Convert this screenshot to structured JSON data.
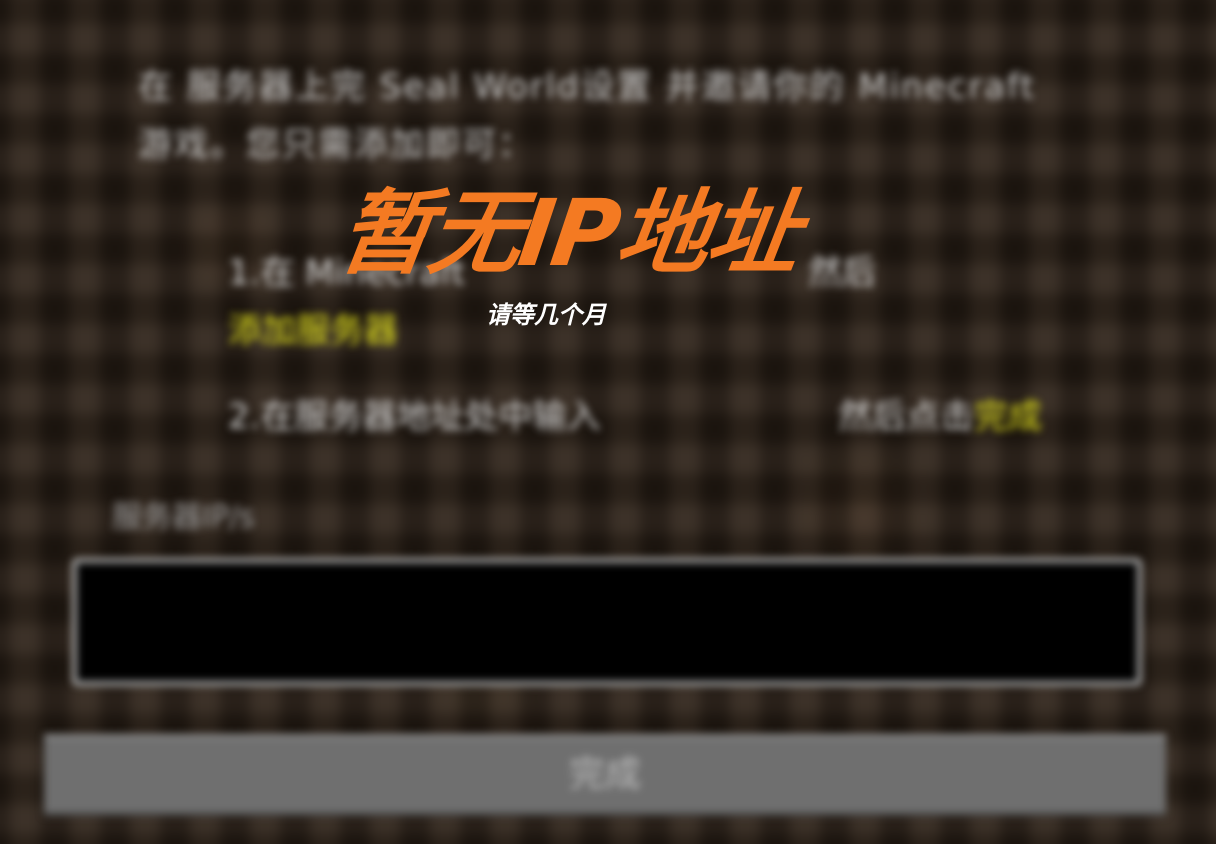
{
  "background": {
    "paragraph": "在 服务器上完 Seal World设置 并邀请你的 Minecraft 游戏。您只需添加即可：",
    "step1_a": "1.在 Minecraft",
    "step1_highlight": "",
    "step1_tail": "然后",
    "step1_line2": "添加服务器",
    "step2_a": "2.在服务器地址处中输入",
    "step2_tail": "然后点击",
    "step2_highlight": "完成",
    "small_label": "服务器IP/s",
    "done_label": "完成"
  },
  "overlay": {
    "title": "暂无IP地址",
    "subtitle": "请等几个月"
  },
  "colors": {
    "title_orange": "#f47a22",
    "highlight_yellow": "#e2e21a"
  }
}
